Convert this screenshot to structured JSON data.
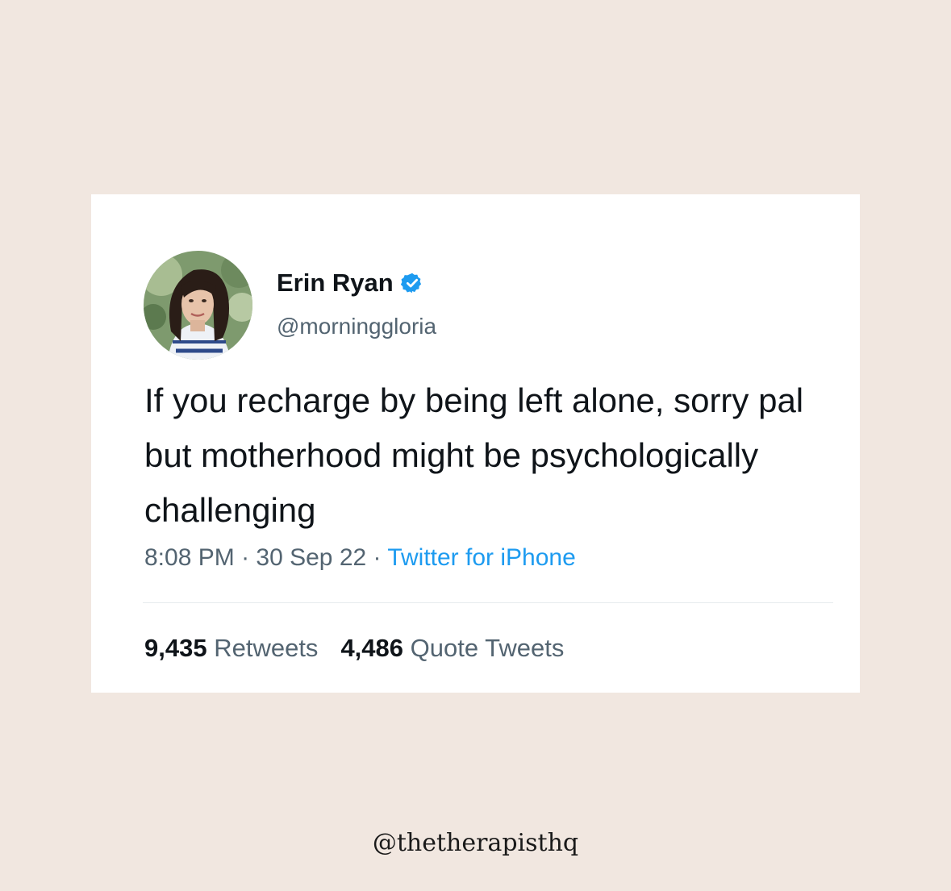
{
  "tweet": {
    "author_name": "Erin Ryan",
    "handle": "@morninggloria",
    "verified_icon": "verified-badge-icon",
    "text": "If you recharge by being left alone, sorry pal but motherhood might be psychologically challenging",
    "time": "8:08 PM",
    "separator": " · ",
    "date": "30 Sep 22",
    "source": "Twitter for iPhone",
    "retweets_count": "9,435",
    "retweets_label": "Retweets",
    "quotes_count": "4,486",
    "quotes_label": "Quote Tweets"
  },
  "credit": "@thetherapisthq",
  "colors": {
    "background": "#f1e7e0",
    "card": "#ffffff",
    "primary_text": "#0f1419",
    "secondary_text": "#536471",
    "link": "#1d9bf0"
  }
}
